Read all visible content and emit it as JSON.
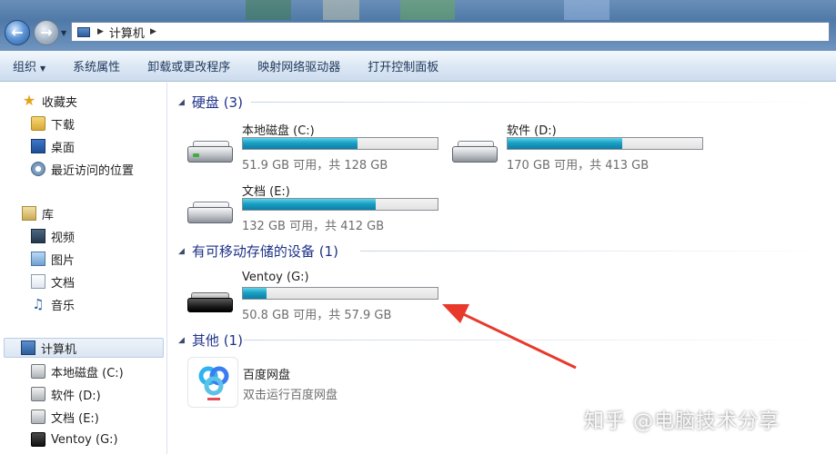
{
  "address": {
    "crumb": "计算机"
  },
  "toolbar": {
    "organize": "组织",
    "properties": "系统属性",
    "uninstall": "卸载或更改程序",
    "map_drive": "映射网络驱动器",
    "control_panel": "打开控制面板"
  },
  "sidebar": {
    "favorites": {
      "label": "收藏夹",
      "items": [
        "下载",
        "桌面",
        "最近访问的位置"
      ]
    },
    "libraries": {
      "label": "库",
      "items": [
        "视频",
        "图片",
        "文档",
        "音乐"
      ]
    },
    "computer": {
      "label": "计算机",
      "items": [
        "本地磁盘 (C:)",
        "软件 (D:)",
        "文档 (E:)",
        "Ventoy (G:)"
      ]
    }
  },
  "groups": {
    "hdd": "硬盘 (3)",
    "removable": "有可移动存储的设备 (1)",
    "other": "其他 (1)"
  },
  "drives": [
    {
      "name": "本地磁盘 (C:)",
      "free": "51.9 GB 可用，共 128 GB",
      "used_fraction": 0.59
    },
    {
      "name": "软件 (D:)",
      "free": "170 GB 可用，共 413 GB",
      "used_fraction": 0.59
    },
    {
      "name": "文档 (E:)",
      "free": "132 GB 可用，共 412 GB",
      "used_fraction": 0.68
    }
  ],
  "removable": [
    {
      "name": "Ventoy (G:)",
      "free": "50.8 GB 可用，共 57.9 GB",
      "used_fraction": 0.12
    }
  ],
  "other": [
    {
      "name": "百度网盘",
      "desc": "双击运行百度网盘"
    }
  ],
  "watermark": "知乎 @电脑技术分享",
  "colors": {
    "bar_fill": "#1aa0c4",
    "annotation_arrow": "#e8392b",
    "group_header": "#1e3287"
  }
}
